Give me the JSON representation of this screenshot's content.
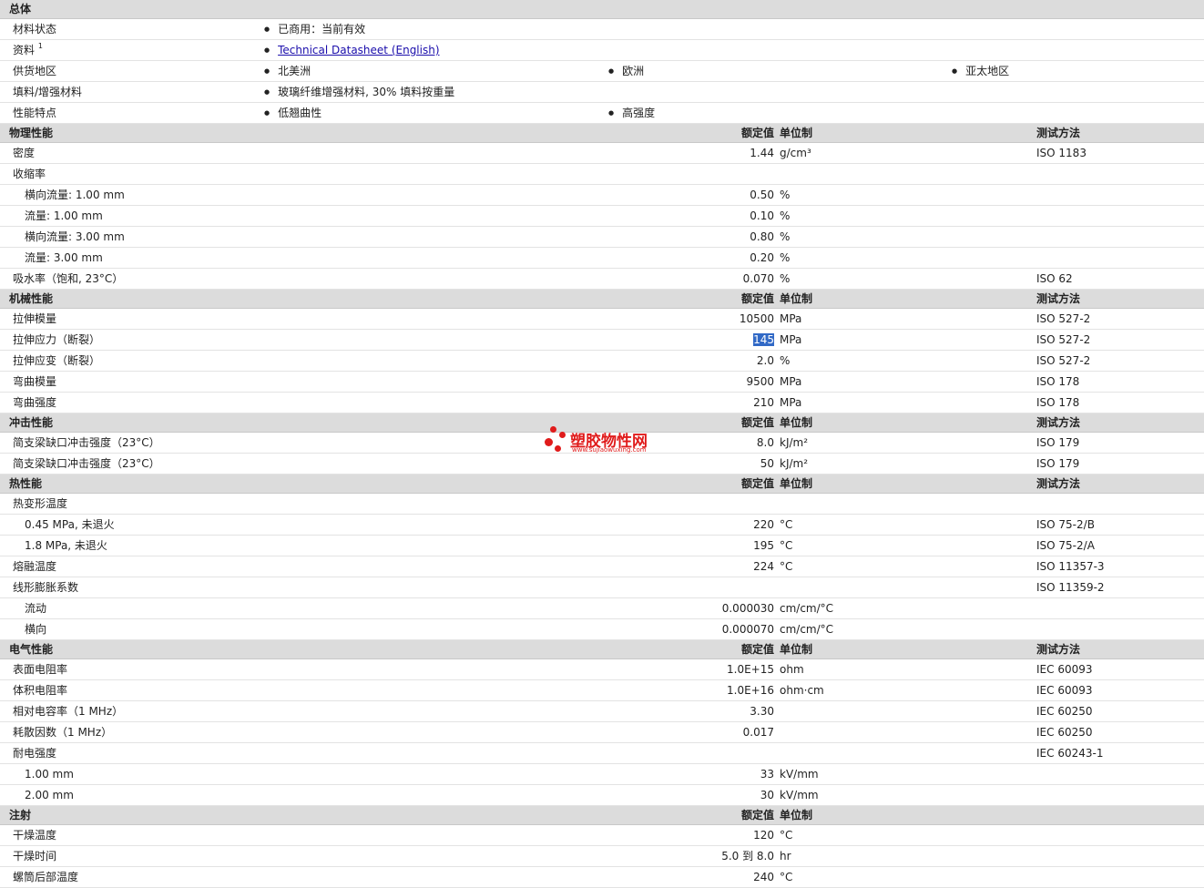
{
  "general": {
    "title": "总体",
    "rows": [
      {
        "label": "材料状态",
        "items": [
          "已商用：当前有效"
        ]
      },
      {
        "label": "资料",
        "sup": "1",
        "link": "Technical Datasheet (English)"
      },
      {
        "label": "供货地区",
        "items": [
          "北美洲",
          "欧洲",
          "亚太地区"
        ]
      },
      {
        "label": "填料/增强材料",
        "items": [
          "玻璃纤维增强材料, 30% 填料按重量"
        ]
      },
      {
        "label": "性能特点",
        "items": [
          "低翘曲性",
          "高强度"
        ]
      }
    ]
  },
  "columns": {
    "value": "额定值",
    "unit": "单位制",
    "test": "测试方法"
  },
  "sections": [
    {
      "title": "物理性能",
      "has_test": true,
      "rows": [
        {
          "label": "密度",
          "value": "1.44",
          "unit": "g/cm³",
          "test": "ISO 1183"
        },
        {
          "label": "收缩率"
        },
        {
          "label": "横向流量: 1.00 mm",
          "sub": true,
          "value": "0.50",
          "unit": "%"
        },
        {
          "label": "流量: 1.00 mm",
          "sub": true,
          "value": "0.10",
          "unit": "%"
        },
        {
          "label": "横向流量: 3.00 mm",
          "sub": true,
          "value": "0.80",
          "unit": "%"
        },
        {
          "label": "流量: 3.00 mm",
          "sub": true,
          "value": "0.20",
          "unit": "%"
        },
        {
          "label": "吸水率（饱和, 23°C）",
          "value": "0.070",
          "unit": "%",
          "test": "ISO 62"
        }
      ]
    },
    {
      "title": "机械性能",
      "has_test": true,
      "rows": [
        {
          "label": "拉伸模量",
          "value": "10500",
          "unit": "MPa",
          "test": "ISO 527-2"
        },
        {
          "label": "拉伸应力（断裂）",
          "value": "145",
          "unit": "MPa",
          "test": "ISO 527-2",
          "selected": true
        },
        {
          "label": "拉伸应变（断裂）",
          "value": "2.0",
          "unit": "%",
          "test": "ISO 527-2"
        },
        {
          "label": "弯曲模量",
          "value": "9500",
          "unit": "MPa",
          "test": "ISO 178"
        },
        {
          "label": "弯曲强度",
          "value": "210",
          "unit": "MPa",
          "test": "ISO 178"
        }
      ]
    },
    {
      "title": "冲击性能",
      "has_test": true,
      "rows": [
        {
          "label": "简支梁缺口冲击强度（23°C）",
          "value": "8.0",
          "unit": "kJ/m²",
          "test": "ISO 179"
        },
        {
          "label": "简支梁缺口冲击强度（23°C）",
          "value": "50",
          "unit": "kJ/m²",
          "test": "ISO 179"
        }
      ]
    },
    {
      "title": "热性能",
      "has_test": true,
      "rows": [
        {
          "label": "热变形温度"
        },
        {
          "label": "0.45 MPa, 未退火",
          "sub": true,
          "value": "220",
          "unit": "°C",
          "test": "ISO 75-2/B"
        },
        {
          "label": "1.8 MPa, 未退火",
          "sub": true,
          "value": "195",
          "unit": "°C",
          "test": "ISO 75-2/A"
        },
        {
          "label": "熔融温度",
          "value": "224",
          "unit": "°C",
          "test": "ISO 11357-3"
        },
        {
          "label": "线形膨胀系数",
          "test": "ISO 11359-2"
        },
        {
          "label": "流动",
          "sub": true,
          "value": "0.000030",
          "unit": "cm/cm/°C"
        },
        {
          "label": "横向",
          "sub": true,
          "value": "0.000070",
          "unit": "cm/cm/°C"
        }
      ]
    },
    {
      "title": "电气性能",
      "has_test": true,
      "rows": [
        {
          "label": "表面电阻率",
          "value": "1.0E+15",
          "unit": "ohm",
          "test": "IEC 60093"
        },
        {
          "label": "体积电阻率",
          "value": "1.0E+16",
          "unit": "ohm·cm",
          "test": "IEC 60093"
        },
        {
          "label": "相对电容率（1 MHz）",
          "value": "3.30",
          "test": "IEC 60250"
        },
        {
          "label": "耗散因数（1 MHz）",
          "value": "0.017",
          "test": "IEC 60250"
        },
        {
          "label": "耐电强度",
          "test": "IEC 60243-1"
        },
        {
          "label": "1.00 mm",
          "sub": true,
          "value": "33",
          "unit": "kV/mm"
        },
        {
          "label": "2.00 mm",
          "sub": true,
          "value": "30",
          "unit": "kV/mm"
        }
      ]
    },
    {
      "title": "注射",
      "has_test": false,
      "rows": [
        {
          "label": "干燥温度",
          "value": "120",
          "unit": "°C"
        },
        {
          "label": "干燥时间",
          "value": "5.0 到  8.0",
          "unit": "hr"
        },
        {
          "label": "螺筒后部温度",
          "value": "240",
          "unit": "°C"
        }
      ]
    }
  ],
  "watermark": {
    "text": "塑胶物性网",
    "url": "www.sujiaowuxing.com"
  }
}
